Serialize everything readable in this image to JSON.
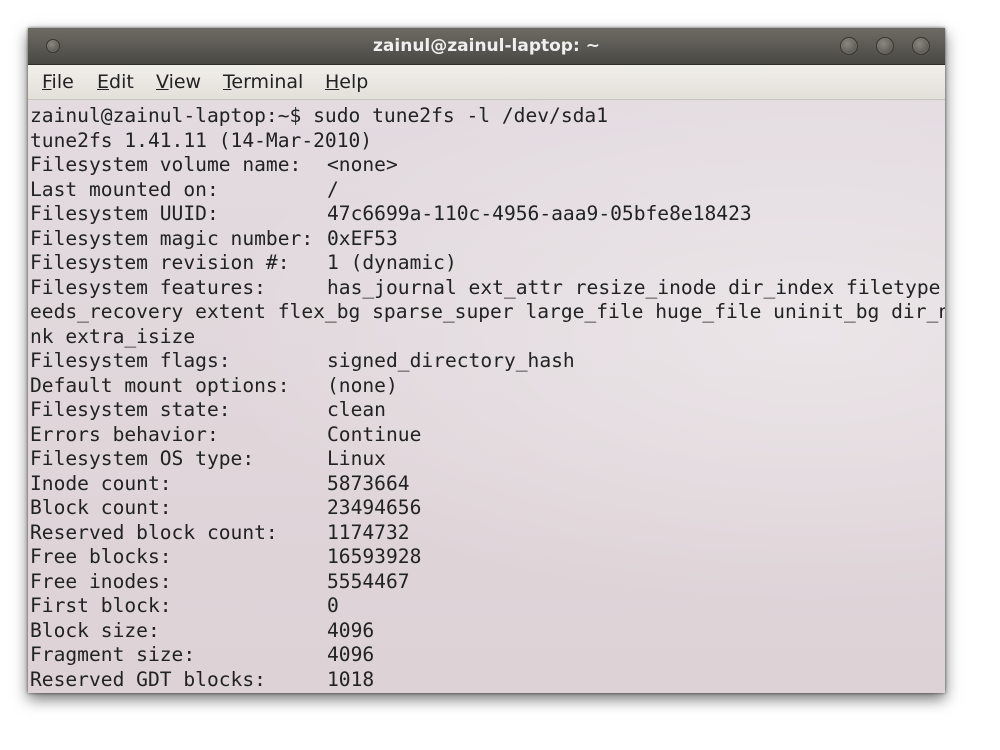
{
  "window": {
    "title": "zainul@zainul-laptop: ~"
  },
  "menu": [
    {
      "before": "",
      "mnemonic": "F",
      "after": "ile"
    },
    {
      "before": "",
      "mnemonic": "E",
      "after": "dit"
    },
    {
      "before": "",
      "mnemonic": "V",
      "after": "iew"
    },
    {
      "before": "",
      "mnemonic": "T",
      "after": "erminal"
    },
    {
      "before": "",
      "mnemonic": "H",
      "after": "elp"
    }
  ],
  "terminal": {
    "prompt": "zainul@zainul-laptop:~$ sudo tune2fs -l /dev/sda1",
    "version": "tune2fs 1.41.11 (14-Mar-2010)",
    "features_wrap_1": "eeds_recovery extent flex_bg sparse_super large_file huge_file uninit_bg dir_nli",
    "features_wrap_2": "nk extra_isize",
    "rows": [
      {
        "label": "Filesystem volume name:",
        "value": "<none>"
      },
      {
        "label": "Last mounted on:",
        "value": "/"
      },
      {
        "label": "Filesystem UUID:",
        "value": "47c6699a-110c-4956-aaa9-05bfe8e18423"
      },
      {
        "label": "Filesystem magic number:",
        "value": "0xEF53"
      },
      {
        "label": "Filesystem revision #:",
        "value": "1 (dynamic)"
      },
      {
        "label": "Filesystem features:",
        "value": "has_journal ext_attr resize_inode dir_index filetype n"
      },
      {
        "label": "Filesystem flags:",
        "value": "signed_directory_hash"
      },
      {
        "label": "Default mount options:",
        "value": "(none)"
      },
      {
        "label": "Filesystem state:",
        "value": "clean"
      },
      {
        "label": "Errors behavior:",
        "value": "Continue"
      },
      {
        "label": "Filesystem OS type:",
        "value": "Linux"
      },
      {
        "label": "Inode count:",
        "value": "5873664"
      },
      {
        "label": "Block count:",
        "value": "23494656"
      },
      {
        "label": "Reserved block count:",
        "value": "1174732"
      },
      {
        "label": "Free blocks:",
        "value": "16593928"
      },
      {
        "label": "Free inodes:",
        "value": "5554467"
      },
      {
        "label": "First block:",
        "value": "0"
      },
      {
        "label": "Block size:",
        "value": "4096"
      },
      {
        "label": "Fragment size:",
        "value": "4096"
      },
      {
        "label": "Reserved GDT blocks:",
        "value": "1018"
      }
    ]
  }
}
